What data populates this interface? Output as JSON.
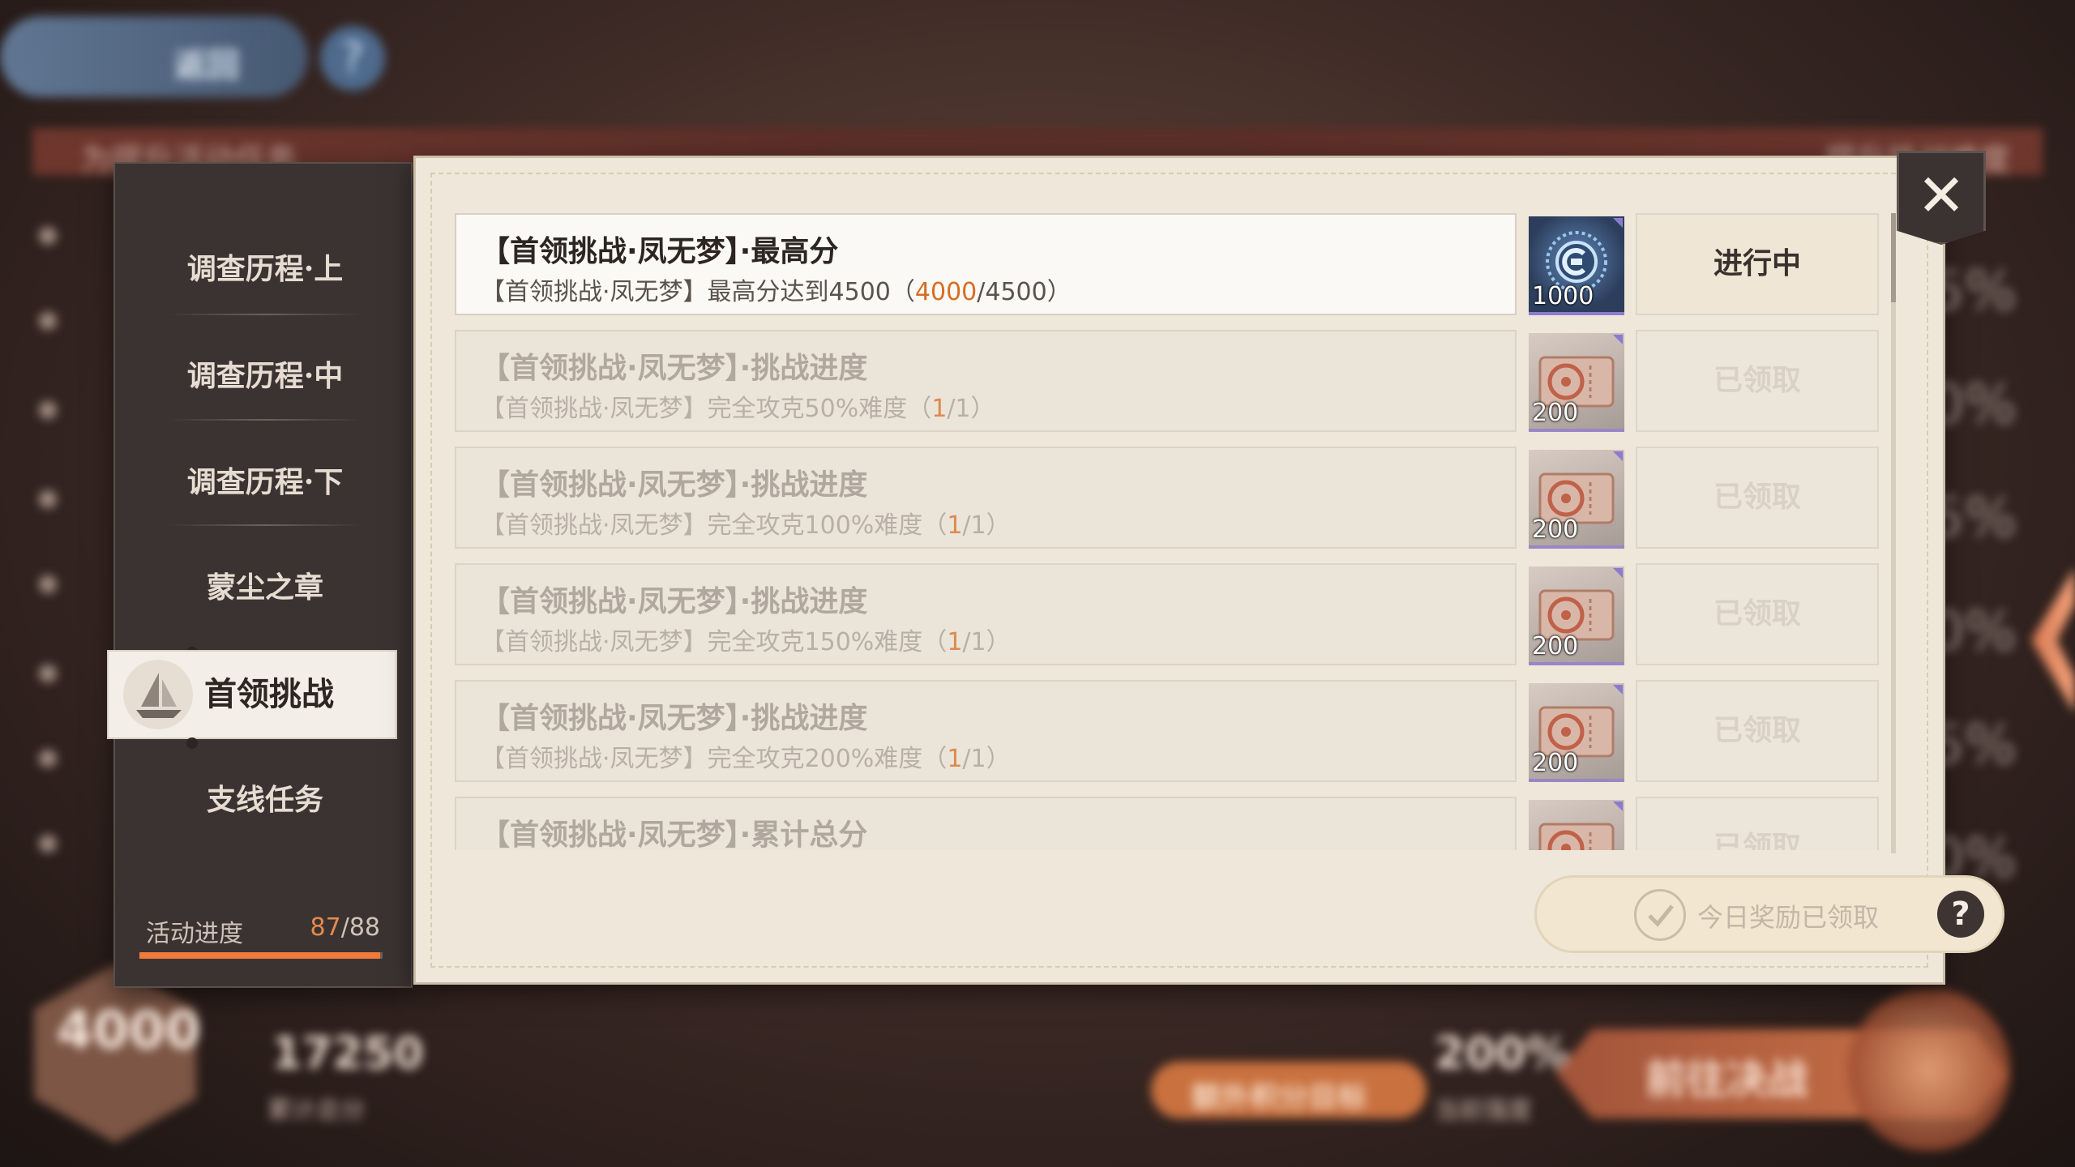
{
  "background": {
    "back_label": "返回",
    "help_glyph": "?",
    "left_banner": "为提升活动任务",
    "right_banner": "提升挑战难度",
    "percents": [
      "5%",
      "0%",
      "5%",
      "0%",
      "5%",
      "0%"
    ],
    "emblem_value": "4000",
    "total_score": "17250",
    "total_score_label": "累计总分",
    "extra_target_label": "额外积分目标",
    "difficulty": "200%",
    "difficulty_label": "当前强度",
    "battle_label": "前往决战"
  },
  "sidebar": {
    "items": [
      {
        "label": "调查历程·上"
      },
      {
        "label": "调查历程·中"
      },
      {
        "label": "调查历程·下"
      },
      {
        "label": "蒙尘之章"
      },
      {
        "label": "首领挑战"
      },
      {
        "label": "支线任务"
      }
    ],
    "active_index": 4,
    "progress_label": "活动进度",
    "progress_current": "87",
    "progress_total": "/88",
    "progress_fraction": 0.989
  },
  "tasks": [
    {
      "title": "【首领挑战·凤无梦】·最高分",
      "desc_prefix": "【首领挑战·凤无梦】最高分达到4500（",
      "current": "4000",
      "desc_suffix": "/4500）",
      "reward_qty": "1000",
      "reward_icon": "emblem-token-icon",
      "status": "进行中"
    },
    {
      "title": "【首领挑战·凤无梦】·挑战进度",
      "desc_prefix": "【首领挑战·凤无梦】完全攻克50%难度（",
      "current": "1",
      "desc_suffix": "/1）",
      "reward_qty": "200",
      "reward_icon": "ticket-icon",
      "status": "已领取"
    },
    {
      "title": "【首领挑战·凤无梦】·挑战进度",
      "desc_prefix": "【首领挑战·凤无梦】完全攻克100%难度（",
      "current": "1",
      "desc_suffix": "/1）",
      "reward_qty": "200",
      "reward_icon": "ticket-icon",
      "status": "已领取"
    },
    {
      "title": "【首领挑战·凤无梦】·挑战进度",
      "desc_prefix": "【首领挑战·凤无梦】完全攻克150%难度（",
      "current": "1",
      "desc_suffix": "/1）",
      "reward_qty": "200",
      "reward_icon": "ticket-icon",
      "status": "已领取"
    },
    {
      "title": "【首领挑战·凤无梦】·挑战进度",
      "desc_prefix": "【首领挑战·凤无梦】完全攻克200%难度（",
      "current": "1",
      "desc_suffix": "/1）",
      "reward_qty": "200",
      "reward_icon": "ticket-icon",
      "status": "已领取"
    },
    {
      "title": "【首领挑战·凤无梦】·累计总分",
      "desc_prefix": "",
      "current": "",
      "desc_suffix": "",
      "reward_qty": "",
      "reward_icon": "ticket-icon",
      "status": "已领取"
    }
  ],
  "daily": {
    "label": "今日奖励已领取",
    "help_glyph": "?"
  },
  "close_glyph": "✕",
  "colors": {
    "accent": "#f07b3a",
    "progress_highlight": "#d66d24",
    "panel": "#efe7d9",
    "sidebar": "#3b3331"
  }
}
